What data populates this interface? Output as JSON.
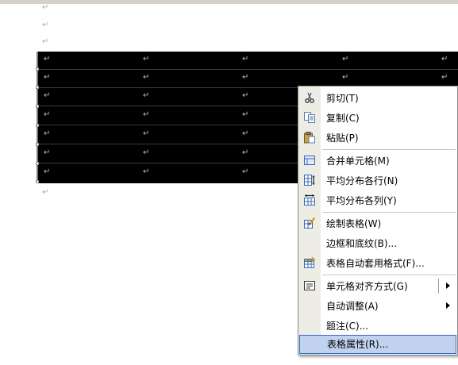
{
  "menu": {
    "items": [
      {
        "label": "剪切(T)",
        "icon": "scissors-icon"
      },
      {
        "label": "复制(C)",
        "icon": "copy-icon"
      },
      {
        "label": "粘贴(P)",
        "icon": "paste-icon"
      },
      {
        "label": "合并单元格(M)",
        "icon": "merge-cells-icon"
      },
      {
        "label": "平均分布各行(N)",
        "icon": "distribute-rows-icon"
      },
      {
        "label": "平均分布各列(Y)",
        "icon": "distribute-columns-icon"
      },
      {
        "label": "绘制表格(W)",
        "icon": "draw-table-icon"
      },
      {
        "label": "边框和底纹(B)..."
      },
      {
        "label": "表格自动套用格式(F)...",
        "icon": "table-autoformat-icon"
      },
      {
        "label": "单元格对齐方式(G)",
        "icon": "cell-alignment-icon",
        "submenu": true
      },
      {
        "label": "自动调整(A)",
        "submenu": true
      },
      {
        "label": "题注(C)..."
      },
      {
        "label": "表格属性(R)...",
        "highlighted": true
      }
    ]
  },
  "colors": {
    "table_selection": "#000000",
    "menu_highlight": "#c1d2ee",
    "menu_highlight_border": "#316ac5",
    "icon_bar": "#eeede5"
  },
  "document": {
    "paragraph_mark": "↵"
  }
}
